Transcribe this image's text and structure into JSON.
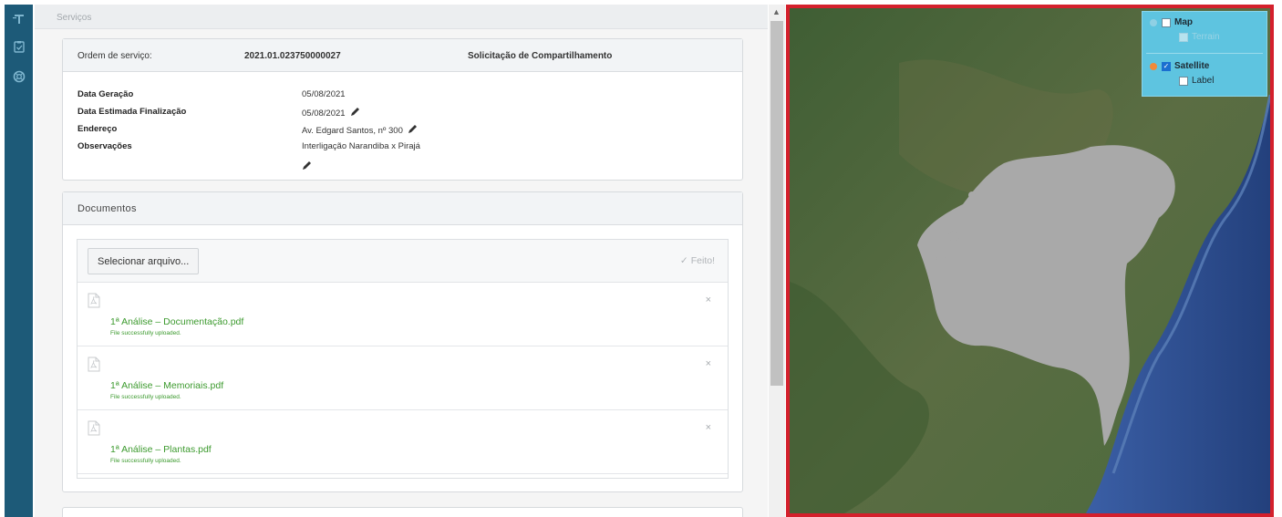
{
  "breadcrumb": {
    "current": "Serviços"
  },
  "order": {
    "label": "Ordem de serviço:",
    "number": "2021.01.023750000027",
    "type": "Solicitação de Compartilhamento",
    "fields": [
      {
        "label": "Data Geração",
        "value": "05/08/2021",
        "editable": false
      },
      {
        "label": "Data Estimada Finalização",
        "value": "05/08/2021",
        "editable": true
      },
      {
        "label": "Endereço",
        "value": "Av. Edgard Santos, nº 300",
        "editable": true
      },
      {
        "label": "Observações",
        "value": "Interligação Narandiba x Pirajá",
        "editable": true
      }
    ]
  },
  "documents": {
    "title": "Documentos",
    "select_button": "Selecionar arquivo...",
    "done_label": "Feito!",
    "files": [
      {
        "name": "1ª Análise – Documentação.pdf",
        "status": "File successfully uploaded."
      },
      {
        "name": "1ª Análise – Memoriais.pdf",
        "status": "File successfully uploaded."
      },
      {
        "name": "1ª Análise – Plantas.pdf",
        "status": "File successfully uploaded."
      }
    ],
    "remove_glyph": "×"
  },
  "map": {
    "layers": {
      "map_label": "Map",
      "map_checked": false,
      "terrain_label": "Terrain",
      "satellite_label": "Satellite",
      "satellite_checked": true,
      "label_label": "Label"
    },
    "colors": {
      "border": "#d4202c",
      "control_bg": "#5ec4e0",
      "highlight_region": "#a9a9a9",
      "ocean": "#2f4f8f"
    }
  },
  "colors": {
    "rail": "#1d5a78",
    "file_text": "#3c9a2e"
  }
}
